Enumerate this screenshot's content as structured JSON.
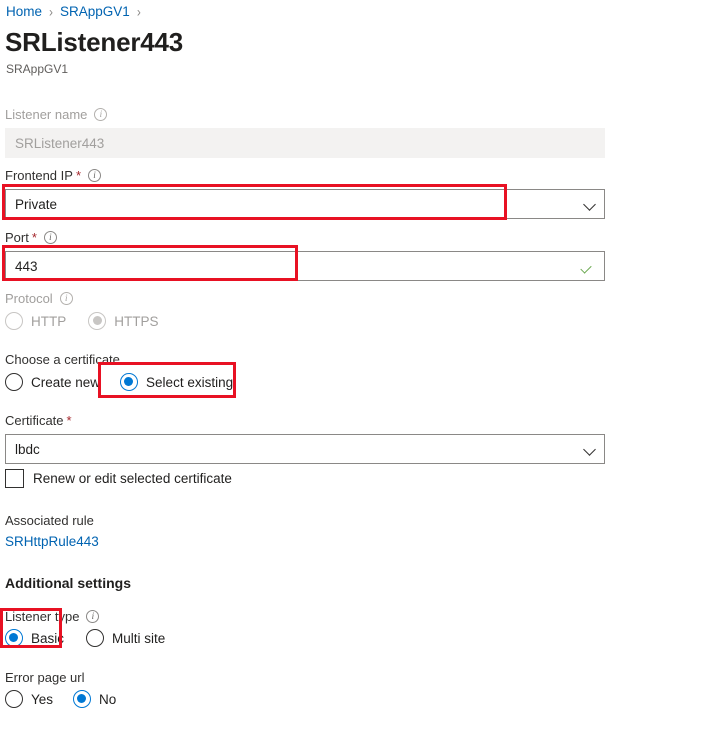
{
  "breadcrumb": {
    "items": [
      {
        "label": "Home"
      },
      {
        "label": "SRAppGV1"
      }
    ],
    "separator": "›"
  },
  "header": {
    "title": "SRListener443",
    "subtitle": "SRAppGV1"
  },
  "form": {
    "listener_name": {
      "label": "Listener name",
      "value": "SRListener443",
      "disabled": true,
      "has_info": true
    },
    "frontend_ip": {
      "label": "Frontend IP",
      "required": true,
      "value": "Private",
      "has_info": true,
      "highlighted": true
    },
    "port": {
      "label": "Port",
      "required": true,
      "value": "443",
      "has_info": true,
      "valid": true,
      "highlighted": true
    },
    "protocol": {
      "label": "Protocol",
      "has_info": true,
      "disabled": true,
      "options": [
        {
          "label": "HTTP",
          "selected": false
        },
        {
          "label": "HTTPS",
          "selected": true
        }
      ]
    },
    "choose_certificate": {
      "label": "Choose a certificate",
      "options": [
        {
          "label": "Create new",
          "selected": false
        },
        {
          "label": "Select existing",
          "selected": true,
          "highlighted": true
        }
      ]
    },
    "certificate": {
      "label": "Certificate",
      "required": true,
      "value": "lbdc"
    },
    "renew_certificate": {
      "label": "Renew or edit selected certificate",
      "checked": false
    },
    "associated_rule": {
      "label": "Associated rule",
      "value": "SRHttpRule443"
    },
    "additional_settings": {
      "heading": "Additional settings"
    },
    "listener_type": {
      "label": "Listener type",
      "has_info": true,
      "options": [
        {
          "label": "Basic",
          "selected": true,
          "highlighted": true
        },
        {
          "label": "Multi site",
          "selected": false
        }
      ]
    },
    "error_page_url": {
      "label": "Error page url",
      "options": [
        {
          "label": "Yes",
          "selected": false
        },
        {
          "label": "No",
          "selected": true
        }
      ]
    }
  },
  "icons": {
    "info": "i"
  },
  "colors": {
    "accent": "#0078d4",
    "link": "#0063b1",
    "required": "#a4262c",
    "highlight": "#e81123",
    "valid": "#6aa84f"
  }
}
